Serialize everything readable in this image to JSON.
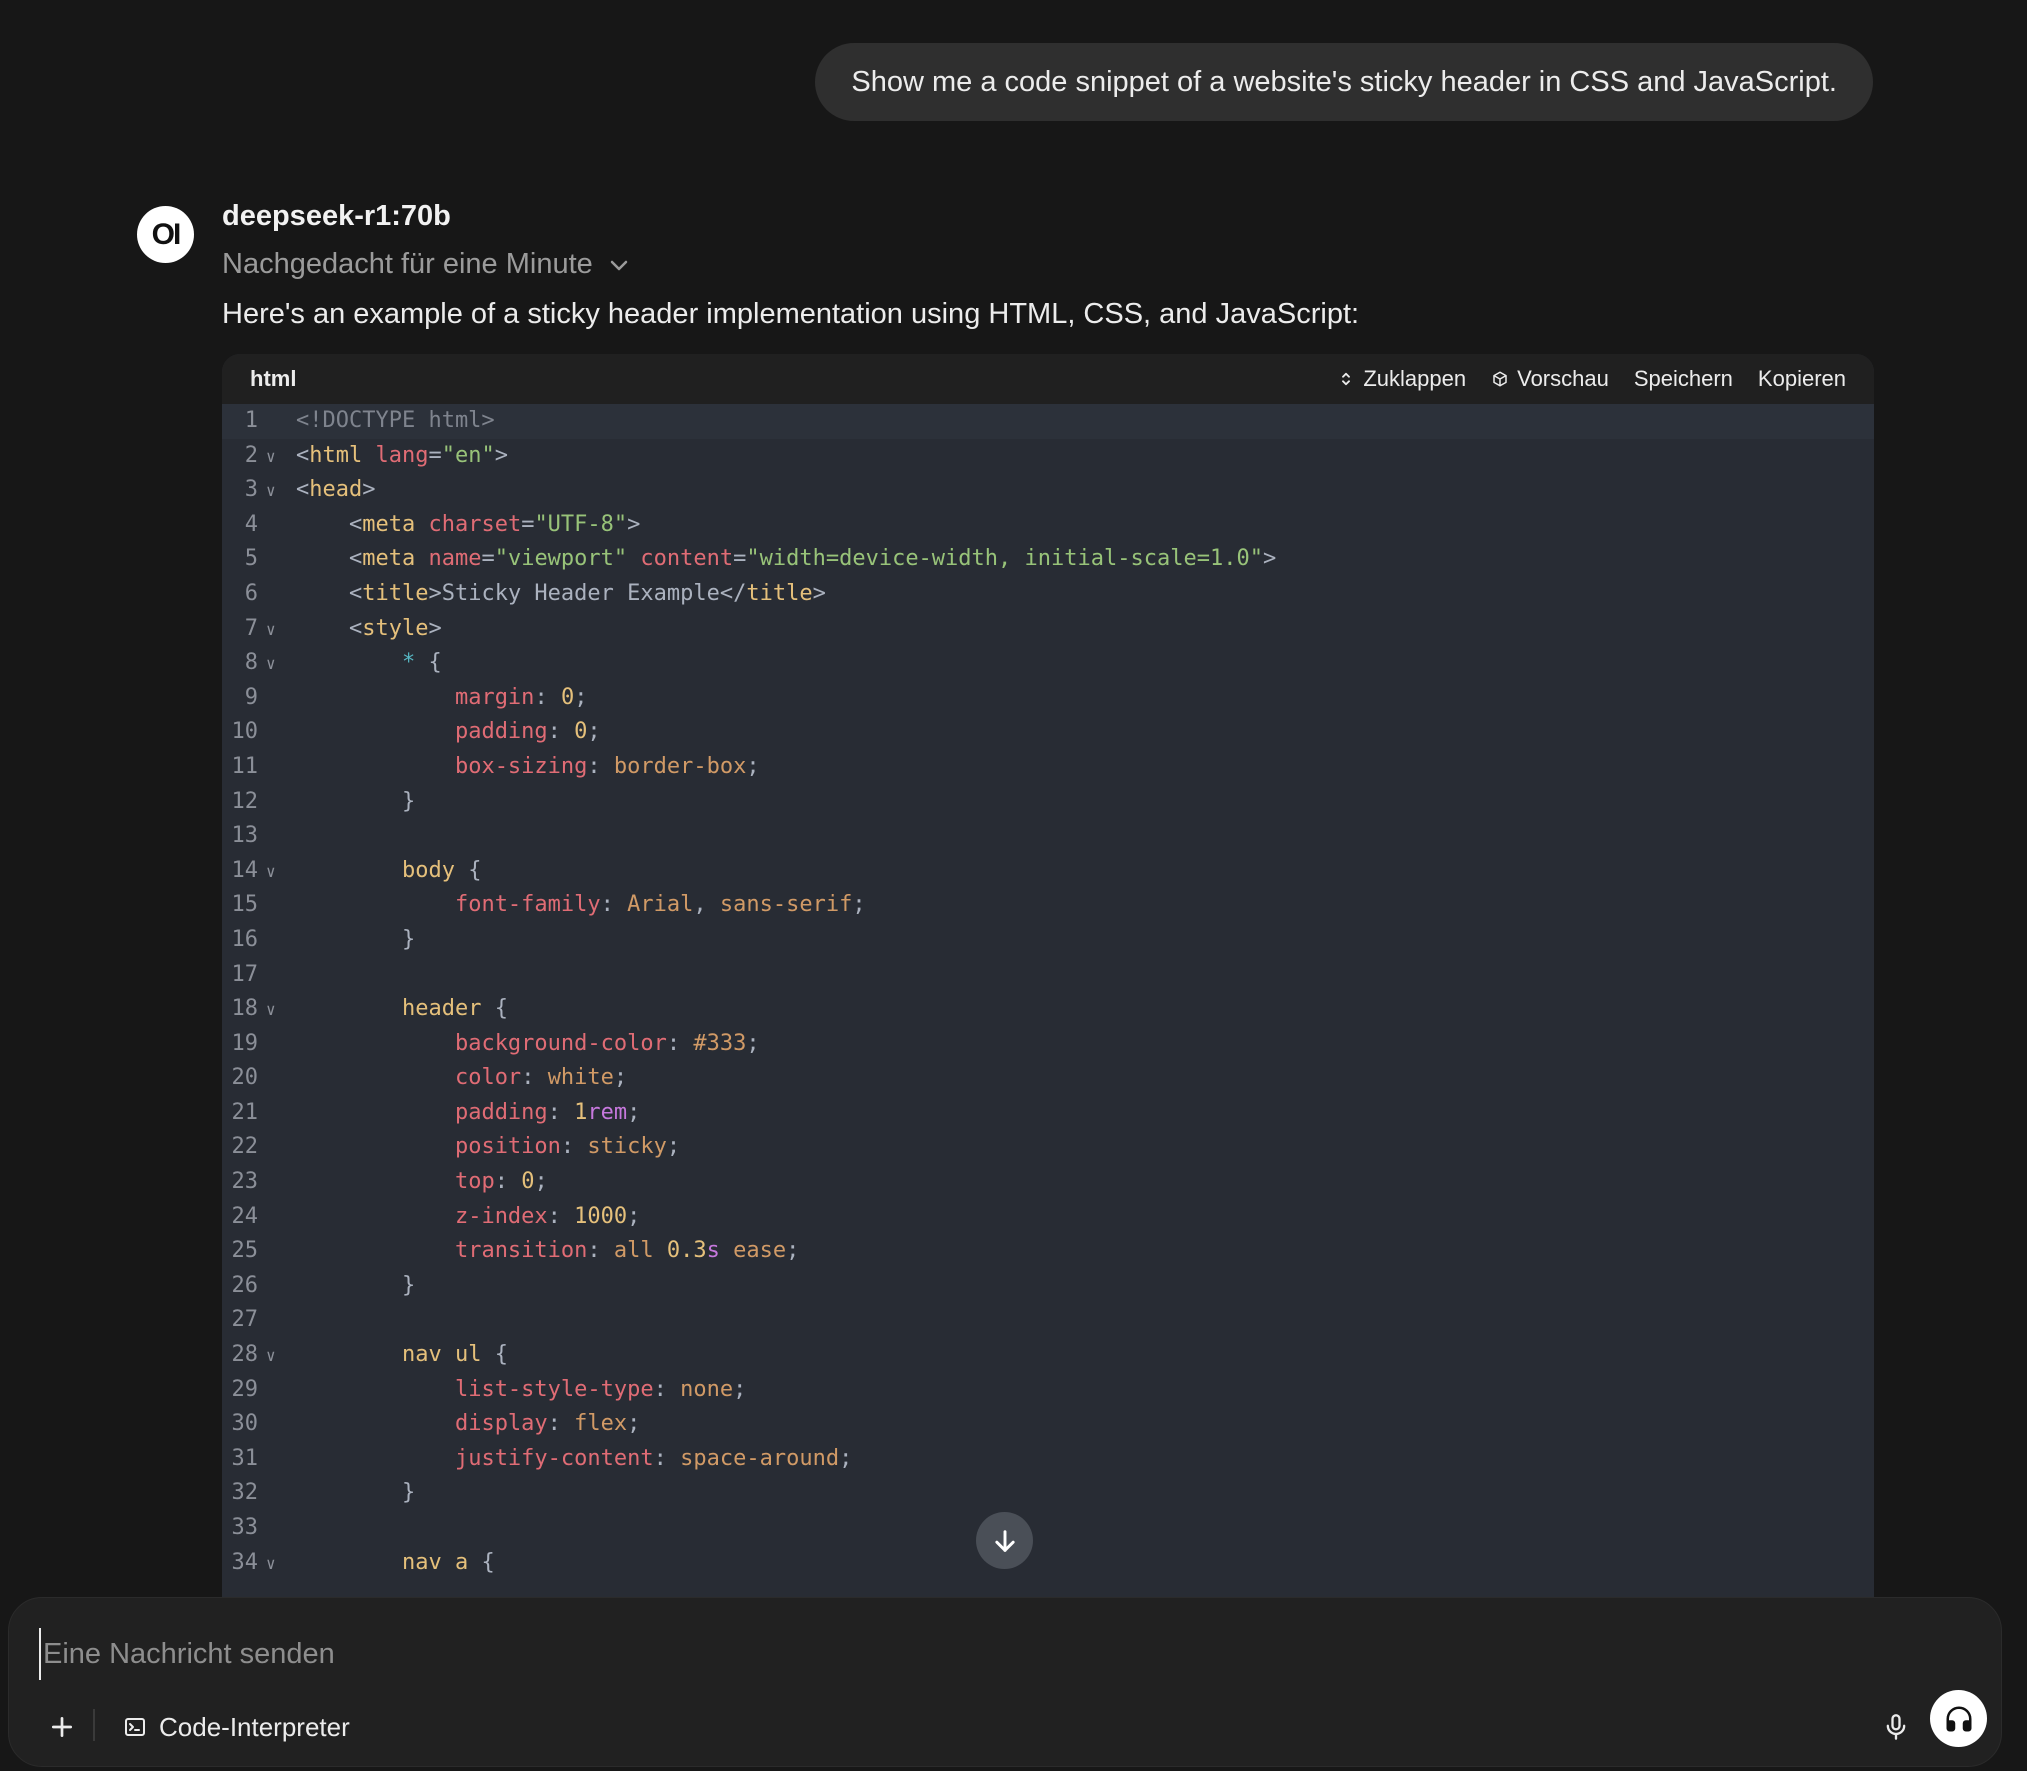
{
  "user_message": "Show me a code snippet of a website's sticky header in CSS and JavaScript.",
  "assistant": {
    "avatar_text": "OI",
    "model_name": "deepseek-r1:70b",
    "thinking_label": "Nachgedacht für eine Minute",
    "intro_text": "Here's an example of a sticky header implementation using HTML, CSS, and JavaScript:"
  },
  "code_block": {
    "language": "html",
    "actions": {
      "collapse": "Zuklappen",
      "preview": "Vorschau",
      "save": "Speichern",
      "copy": "Kopieren"
    },
    "lines": [
      {
        "n": "1",
        "fold": false,
        "segs": [
          [
            "comment",
            "<!DOCTYPE html>"
          ]
        ]
      },
      {
        "n": "2",
        "fold": true,
        "segs": [
          [
            "plain",
            "<"
          ],
          [
            "tag",
            "html"
          ],
          [
            "plain",
            " "
          ],
          [
            "attr",
            "lang"
          ],
          [
            "plain",
            "="
          ],
          [
            "str",
            "\"en\""
          ],
          [
            "plain",
            ">"
          ]
        ]
      },
      {
        "n": "3",
        "fold": true,
        "segs": [
          [
            "plain",
            "<"
          ],
          [
            "tag",
            "head"
          ],
          [
            "plain",
            ">"
          ]
        ]
      },
      {
        "n": "4",
        "fold": false,
        "segs": [
          [
            "plain",
            "    <"
          ],
          [
            "tag",
            "meta"
          ],
          [
            "plain",
            " "
          ],
          [
            "attr",
            "charset"
          ],
          [
            "plain",
            "="
          ],
          [
            "str",
            "\"UTF-8\""
          ],
          [
            "plain",
            ">"
          ]
        ]
      },
      {
        "n": "5",
        "fold": false,
        "segs": [
          [
            "plain",
            "    <"
          ],
          [
            "tag",
            "meta"
          ],
          [
            "plain",
            " "
          ],
          [
            "attr",
            "name"
          ],
          [
            "plain",
            "="
          ],
          [
            "str",
            "\"viewport\""
          ],
          [
            "plain",
            " "
          ],
          [
            "attr",
            "content"
          ],
          [
            "plain",
            "="
          ],
          [
            "str",
            "\"width=device-width, initial-scale=1.0\""
          ],
          [
            "plain",
            ">"
          ]
        ]
      },
      {
        "n": "6",
        "fold": false,
        "segs": [
          [
            "plain",
            "    <"
          ],
          [
            "tag",
            "title"
          ],
          [
            "plain",
            ">Sticky Header Example</"
          ],
          [
            "tag",
            "title"
          ],
          [
            "plain",
            ">"
          ]
        ]
      },
      {
        "n": "7",
        "fold": true,
        "segs": [
          [
            "plain",
            "    <"
          ],
          [
            "tag",
            "style"
          ],
          [
            "plain",
            ">"
          ]
        ]
      },
      {
        "n": "8",
        "fold": true,
        "segs": [
          [
            "plain",
            "        "
          ],
          [
            "star",
            "*"
          ],
          [
            "plain",
            " {"
          ]
        ]
      },
      {
        "n": "9",
        "fold": false,
        "segs": [
          [
            "plain",
            "            "
          ],
          [
            "prop",
            "margin"
          ],
          [
            "plain",
            ": "
          ],
          [
            "num",
            "0"
          ],
          [
            "plain",
            ";"
          ]
        ]
      },
      {
        "n": "10",
        "fold": false,
        "segs": [
          [
            "plain",
            "            "
          ],
          [
            "prop",
            "padding"
          ],
          [
            "plain",
            ": "
          ],
          [
            "num",
            "0"
          ],
          [
            "plain",
            ";"
          ]
        ]
      },
      {
        "n": "11",
        "fold": false,
        "segs": [
          [
            "plain",
            "            "
          ],
          [
            "prop",
            "box-sizing"
          ],
          [
            "plain",
            ": "
          ],
          [
            "val",
            "border-box"
          ],
          [
            "plain",
            ";"
          ]
        ]
      },
      {
        "n": "12",
        "fold": false,
        "segs": [
          [
            "plain",
            "        }"
          ]
        ]
      },
      {
        "n": "13",
        "fold": false,
        "segs": [
          [
            "plain",
            ""
          ]
        ]
      },
      {
        "n": "14",
        "fold": true,
        "segs": [
          [
            "plain",
            "        "
          ],
          [
            "sel",
            "body"
          ],
          [
            "plain",
            " {"
          ]
        ]
      },
      {
        "n": "15",
        "fold": false,
        "segs": [
          [
            "plain",
            "            "
          ],
          [
            "prop",
            "font-family"
          ],
          [
            "plain",
            ": "
          ],
          [
            "val",
            "Arial"
          ],
          [
            "plain",
            ", "
          ],
          [
            "val",
            "sans-serif"
          ],
          [
            "plain",
            ";"
          ]
        ]
      },
      {
        "n": "16",
        "fold": false,
        "segs": [
          [
            "plain",
            "        }"
          ]
        ]
      },
      {
        "n": "17",
        "fold": false,
        "segs": [
          [
            "plain",
            ""
          ]
        ]
      },
      {
        "n": "18",
        "fold": true,
        "segs": [
          [
            "plain",
            "        "
          ],
          [
            "sel",
            "header"
          ],
          [
            "plain",
            " {"
          ]
        ]
      },
      {
        "n": "19",
        "fold": false,
        "segs": [
          [
            "plain",
            "            "
          ],
          [
            "prop",
            "background-color"
          ],
          [
            "plain",
            ": "
          ],
          [
            "val",
            "#333"
          ],
          [
            "plain",
            ";"
          ]
        ]
      },
      {
        "n": "20",
        "fold": false,
        "segs": [
          [
            "plain",
            "            "
          ],
          [
            "prop",
            "color"
          ],
          [
            "plain",
            ": "
          ],
          [
            "val",
            "white"
          ],
          [
            "plain",
            ";"
          ]
        ]
      },
      {
        "n": "21",
        "fold": false,
        "segs": [
          [
            "plain",
            "            "
          ],
          [
            "prop",
            "padding"
          ],
          [
            "plain",
            ": "
          ],
          [
            "num",
            "1"
          ],
          [
            "unit",
            "rem"
          ],
          [
            "plain",
            ";"
          ]
        ]
      },
      {
        "n": "22",
        "fold": false,
        "segs": [
          [
            "plain",
            "            "
          ],
          [
            "prop",
            "position"
          ],
          [
            "plain",
            ": "
          ],
          [
            "val",
            "sticky"
          ],
          [
            "plain",
            ";"
          ]
        ]
      },
      {
        "n": "23",
        "fold": false,
        "segs": [
          [
            "plain",
            "            "
          ],
          [
            "prop",
            "top"
          ],
          [
            "plain",
            ": "
          ],
          [
            "num",
            "0"
          ],
          [
            "plain",
            ";"
          ]
        ]
      },
      {
        "n": "24",
        "fold": false,
        "segs": [
          [
            "plain",
            "            "
          ],
          [
            "prop",
            "z-index"
          ],
          [
            "plain",
            ": "
          ],
          [
            "num",
            "1000"
          ],
          [
            "plain",
            ";"
          ]
        ]
      },
      {
        "n": "25",
        "fold": false,
        "segs": [
          [
            "plain",
            "            "
          ],
          [
            "prop",
            "transition"
          ],
          [
            "plain",
            ": "
          ],
          [
            "val",
            "all"
          ],
          [
            "plain",
            " "
          ],
          [
            "num",
            "0.3"
          ],
          [
            "unit",
            "s"
          ],
          [
            "plain",
            " "
          ],
          [
            "val",
            "ease"
          ],
          [
            "plain",
            ";"
          ]
        ]
      },
      {
        "n": "26",
        "fold": false,
        "segs": [
          [
            "plain",
            "        }"
          ]
        ]
      },
      {
        "n": "27",
        "fold": false,
        "segs": [
          [
            "plain",
            ""
          ]
        ]
      },
      {
        "n": "28",
        "fold": true,
        "segs": [
          [
            "plain",
            "        "
          ],
          [
            "sel",
            "nav ul"
          ],
          [
            "plain",
            " {"
          ]
        ]
      },
      {
        "n": "29",
        "fold": false,
        "segs": [
          [
            "plain",
            "            "
          ],
          [
            "prop",
            "list-style-type"
          ],
          [
            "plain",
            ": "
          ],
          [
            "val",
            "none"
          ],
          [
            "plain",
            ";"
          ]
        ]
      },
      {
        "n": "30",
        "fold": false,
        "segs": [
          [
            "plain",
            "            "
          ],
          [
            "prop",
            "display"
          ],
          [
            "plain",
            ": "
          ],
          [
            "val",
            "flex"
          ],
          [
            "plain",
            ";"
          ]
        ]
      },
      {
        "n": "31",
        "fold": false,
        "segs": [
          [
            "plain",
            "            "
          ],
          [
            "prop",
            "justify-content"
          ],
          [
            "plain",
            ": "
          ],
          [
            "val",
            "space-around"
          ],
          [
            "plain",
            ";"
          ]
        ]
      },
      {
        "n": "32",
        "fold": false,
        "segs": [
          [
            "plain",
            "        }"
          ]
        ]
      },
      {
        "n": "33",
        "fold": false,
        "segs": [
          [
            "plain",
            ""
          ]
        ]
      },
      {
        "n": "34",
        "fold": true,
        "segs": [
          [
            "plain",
            "        "
          ],
          [
            "sel",
            "nav a"
          ],
          [
            "plain",
            " {"
          ]
        ]
      }
    ]
  },
  "composer": {
    "placeholder": "Eine Nachricht senden",
    "tool_label": "Code-Interpreter"
  },
  "colors": {
    "background": "#171717",
    "user_bubble": "#2f2f2f",
    "code_bg": "#282c34",
    "code_header_bg": "#202020",
    "composer_bg": "#212121"
  }
}
